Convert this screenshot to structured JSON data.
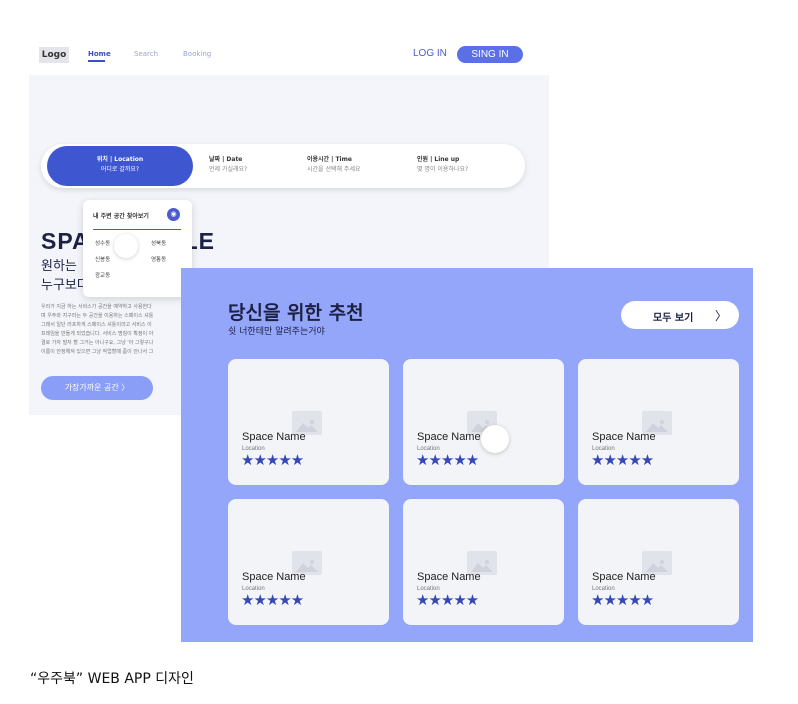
{
  "back_screen": {
    "nav": {
      "logo": "Logo",
      "links": [
        "Home",
        "Search",
        "Booking"
      ],
      "login": "LOG IN",
      "signin": "SING IN"
    },
    "search_bar": {
      "segments": [
        {
          "title": "위치 | Location",
          "sub": "어디로 갈까요?"
        },
        {
          "title": "날짜 | Date",
          "sub": "언제 가실래요?"
        },
        {
          "title": "이용시간 | Time",
          "sub": "시간을 선택해 주세요"
        },
        {
          "title": "인원 | Line up",
          "sub": "몇 명이 이용하나요?"
        }
      ]
    },
    "dropdown": {
      "title": "내 주변 공간 찾아보기",
      "items": [
        "성수동",
        "성북동",
        "신봉동",
        "영통동",
        "광교동"
      ]
    },
    "hero": {
      "title": "SPA",
      "title_end": "LE",
      "subtitle_1": "원하는",
      "subtitle_2": "누구보다",
      "body": [
        "우리가 지금 하는 서비스가 공간을 예약하고 사용한다",
        "며 우주와 지구라는 두 공간을 이용하는 스페이스 셔틀",
        "그래서 일단 러프하게 스페이스 셔틀이라고 서비스 이",
        "프레임을 만들게 되었습니다. 서비스 명칭이 확정이 아",
        "결로 가자 말자 할 그거는 아니구요, 그냥 '아 그렇구나",
        "이름이 안정해져 있으면 그냥 작업할때 좀이 안나서 그"
      ],
      "cta": "가장가까운 공간  〉"
    }
  },
  "front_screen": {
    "title": "당신을 위한 추천",
    "subtitle": "쉿 너한테만 알려주는거야",
    "view_all": "모두 보기",
    "view_all_chevron": "〉",
    "cards": [
      {
        "name": "Space Name",
        "location": "Location",
        "stars": "★★★★★"
      },
      {
        "name": "Space Name",
        "location": "Location",
        "stars": "★★★★★"
      },
      {
        "name": "Space Name",
        "location": "Location",
        "stars": "★★★★★"
      },
      {
        "name": "Space Name",
        "location": "Location",
        "stars": "★★★★★"
      },
      {
        "name": "Space Name",
        "location": "Location",
        "stars": "★★★★★"
      },
      {
        "name": "Space Name",
        "location": "Location",
        "stars": "★★★★★"
      }
    ],
    "rating": 5
  },
  "caption": "“우주북” WEB APP 디자인",
  "colors": {
    "primary": "#3f56d1",
    "accent_panel": "#94a6fa",
    "cta": "#8a9ef7",
    "star": "#3548b5"
  }
}
